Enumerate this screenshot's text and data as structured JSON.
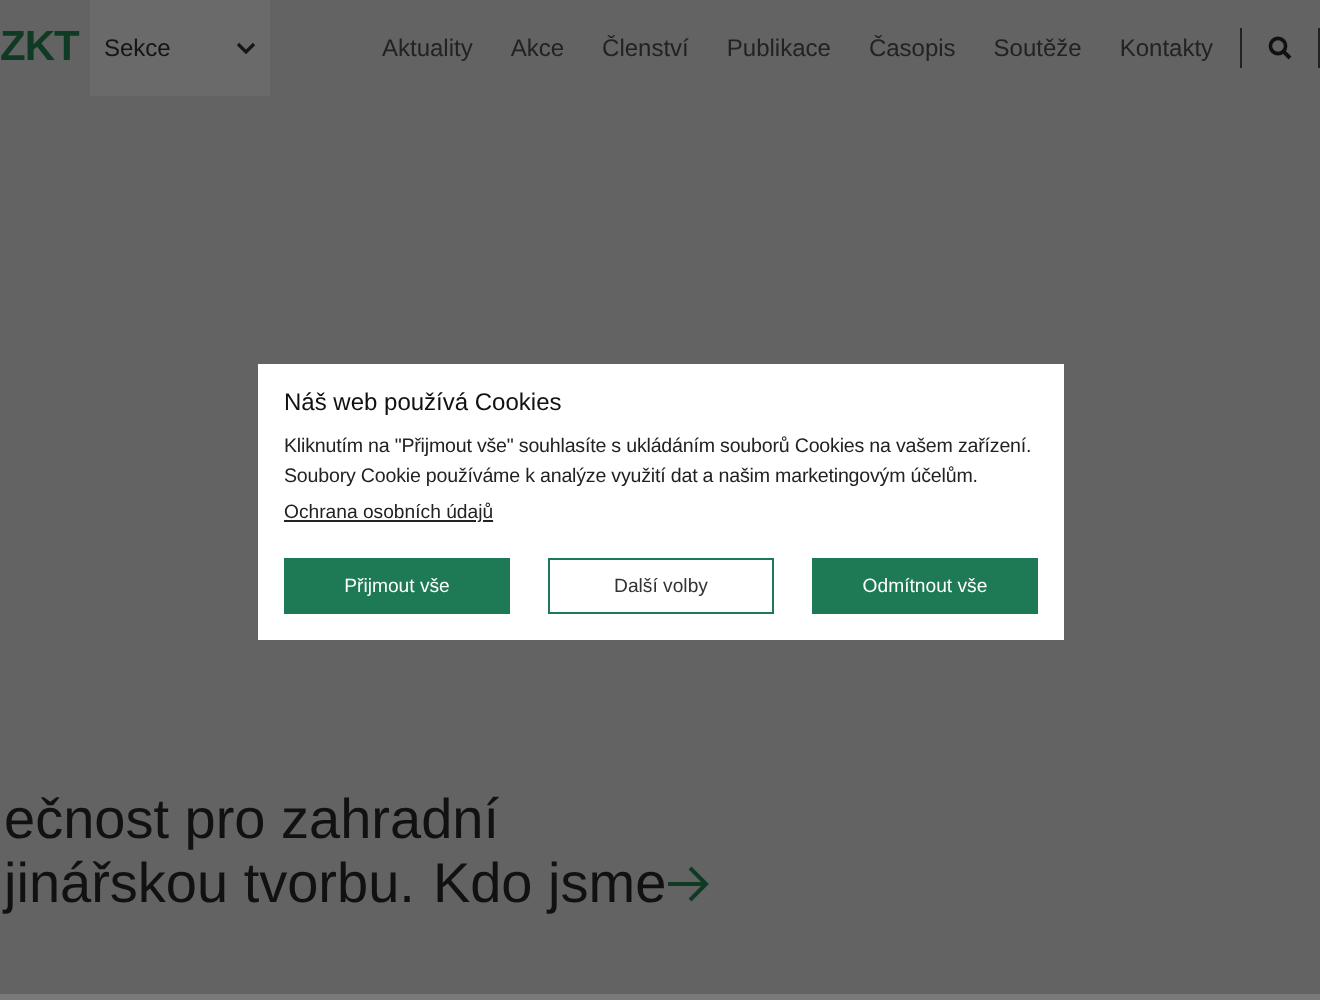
{
  "header": {
    "logo": "ZKT",
    "section_select": {
      "value": "Sekce"
    },
    "nav": [
      "Aktuality",
      "Akce",
      "Členství",
      "Publikace",
      "Časopis",
      "Soutěže",
      "Kontakty"
    ]
  },
  "hero": {
    "lines": [
      "ečnost pro zahradní",
      "jinářskou tvorbu."
    ],
    "link": "Kdo jsme"
  },
  "cookie_dialog": {
    "title": "Náš web používá Cookies",
    "text": "Kliknutím na \"Přijmout vše\" souhlasíte s ukládáním souborů Cookies na vašem zařízení. Soubory Cookie používáme k analýze využití dat a našim marketingovým účelům.",
    "privacy_link": "Ochrana osobních údajů",
    "buttons": [
      {
        "label": "Přijmout vše",
        "kind": "primary"
      },
      {
        "label": "Další volby",
        "kind": "outline"
      },
      {
        "label": "Odmítnout vše",
        "kind": "primary"
      }
    ]
  }
}
